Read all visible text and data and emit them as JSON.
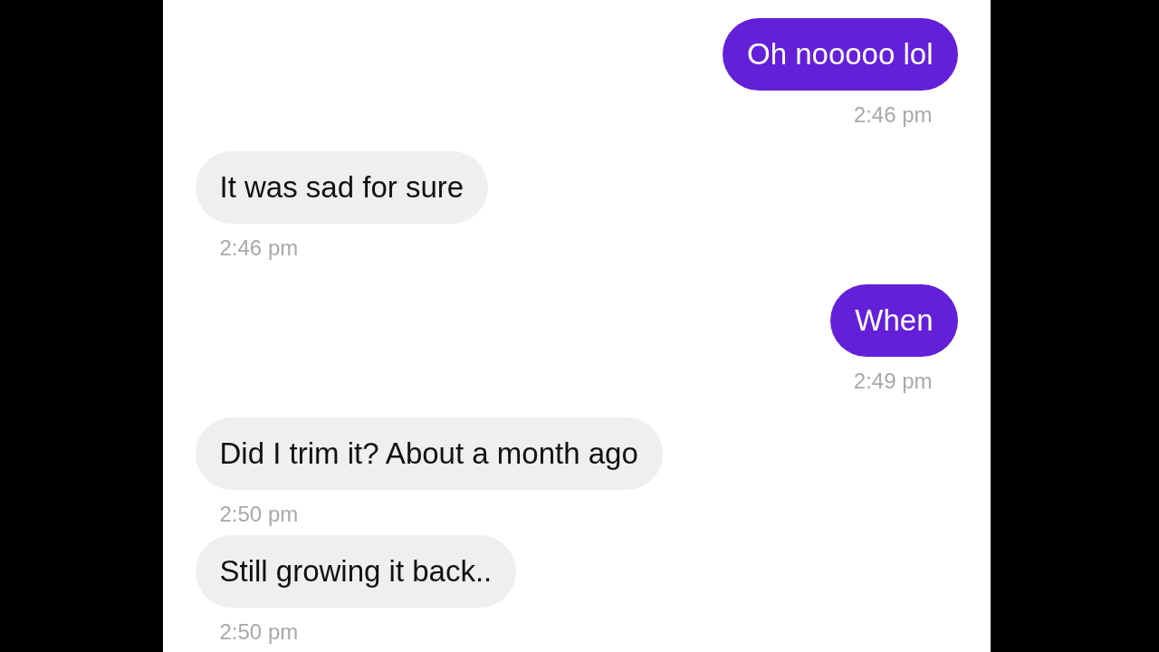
{
  "messages": [
    {
      "kind": "outgoing",
      "text": "Oh nooooo lol",
      "time": "2:46 pm"
    },
    {
      "kind": "incoming",
      "text": "It was sad for sure",
      "time": "2:46 pm"
    },
    {
      "kind": "outgoing",
      "text": "When",
      "time": "2:49 pm"
    },
    {
      "kind": "incoming",
      "text": "Did I trim it? About a month ago",
      "time": "2:50 pm"
    },
    {
      "kind": "incoming",
      "text": "Still growing it back..",
      "time": "2:50 pm"
    }
  ]
}
